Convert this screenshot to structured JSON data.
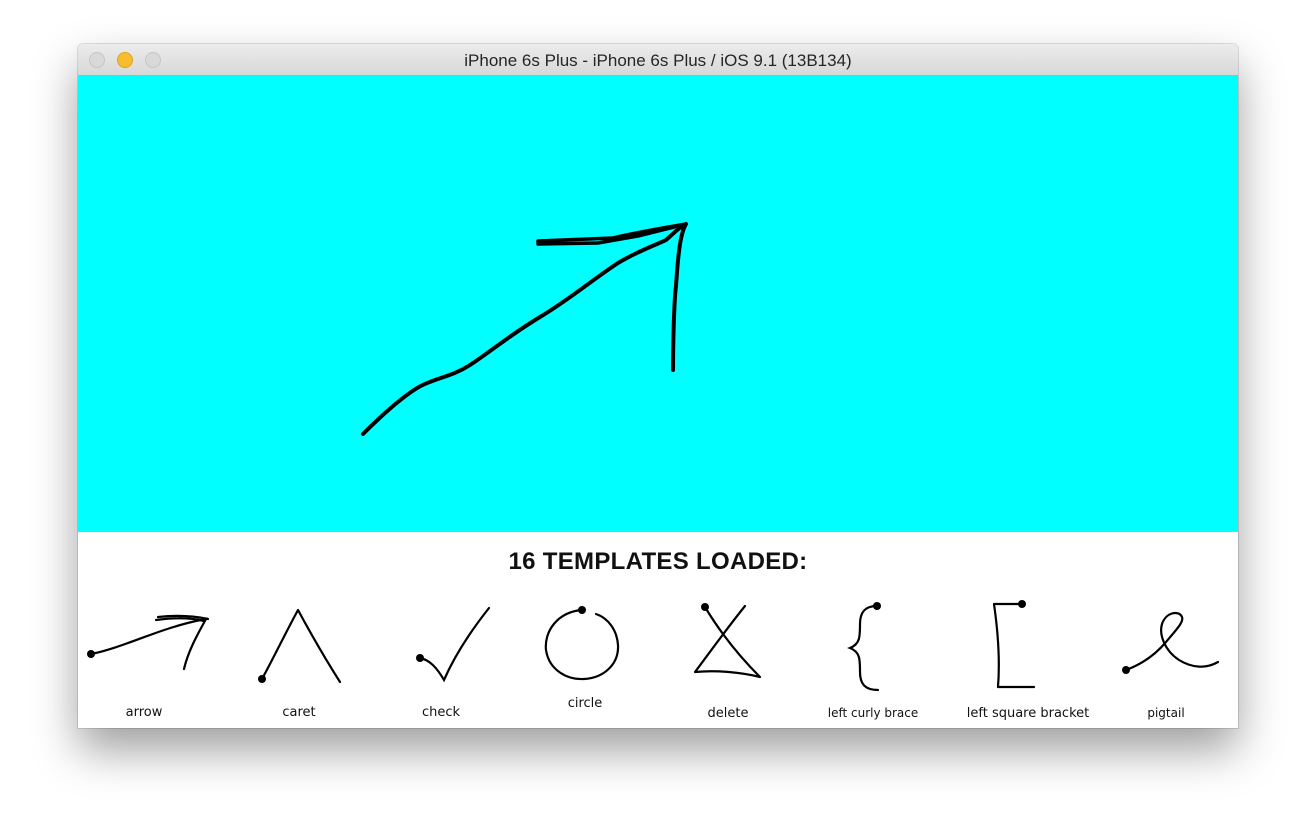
{
  "window": {
    "title": "iPhone 6s Plus - iPhone 6s Plus / iOS 9.1 (13B134)"
  },
  "canvas": {
    "background": "#00ffff",
    "stroke_color": "#000000"
  },
  "panel": {
    "heading": "16 TEMPLATES LOADED:"
  },
  "templates": [
    {
      "label": "arrow",
      "icon": "arrow-gesture-icon"
    },
    {
      "label": "caret",
      "icon": "caret-gesture-icon"
    },
    {
      "label": "check",
      "icon": "check-gesture-icon"
    },
    {
      "label": "circle",
      "icon": "circle-gesture-icon"
    },
    {
      "label": "delete",
      "icon": "delete-gesture-icon"
    },
    {
      "label": "left curly brace",
      "icon": "left-curly-brace-gesture-icon"
    },
    {
      "label": "left square bracket",
      "icon": "left-square-bracket-gesture-icon"
    },
    {
      "label": "pigtail",
      "icon": "pigtail-gesture-icon"
    }
  ]
}
